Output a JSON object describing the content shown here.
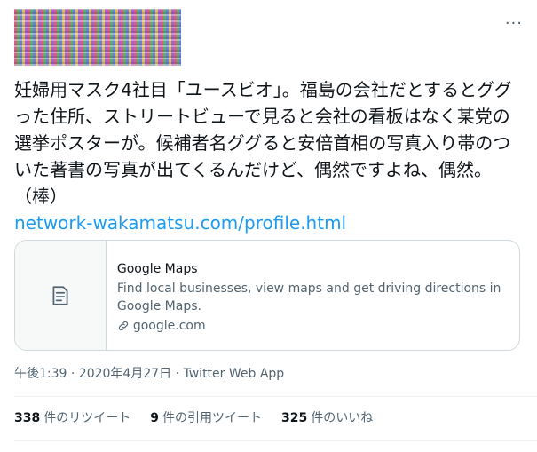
{
  "tweet": {
    "text": "妊婦用マスク4社目「ユースビオ」。福島の会社だとするとググった住所、ストリートビューで見ると会社の看板はなく某党の選挙ポスターが。候補者名ググると安倍首相の写真入り帯のついた著書の写真が出てくるんだけど、偶然ですよね、偶然。（棒）",
    "link": "network-wakamatsu.com/profile.html",
    "timestamp": "午後1:39 · 2020年4月27日 · Twitter Web App",
    "more_label": "···"
  },
  "card": {
    "title": "Google Maps",
    "description": "Find local businesses, view maps and get driving directions in Google Maps.",
    "domain": "google.com"
  },
  "stats": {
    "retweets_count": "338",
    "retweets_label": "件のリツイート",
    "quotes_count": "9",
    "quotes_label": "件の引用ツイート",
    "likes_count": "325",
    "likes_label": "件のいいね"
  },
  "colors": {
    "link": "#1d9bf0",
    "secondary_text": "#536471",
    "border": "#cfd9de"
  }
}
